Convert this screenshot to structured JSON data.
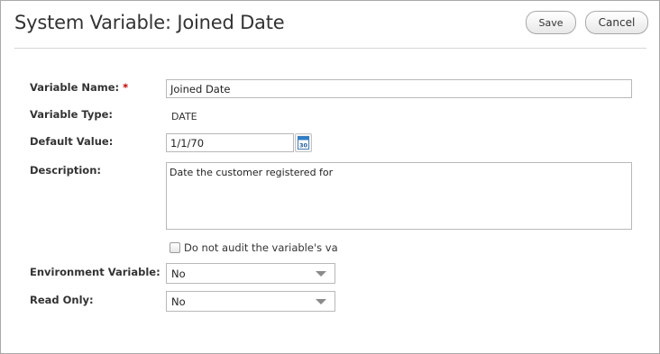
{
  "header": {
    "title": "System Variable: Joined Date",
    "save_label": "Save",
    "cancel_label": "Cancel"
  },
  "form": {
    "variable_name": {
      "label": "Variable Name:",
      "required_mark": "*",
      "value": "Joined Date"
    },
    "variable_type": {
      "label": "Variable Type:",
      "value": "DATE"
    },
    "default_value": {
      "label": "Default Value:",
      "value": "1/1/70",
      "calendar_day": "30"
    },
    "description": {
      "label": "Description:",
      "value": "Date the customer registered for"
    },
    "audit_checkbox": {
      "label": "Do not audit the variable's va",
      "checked": false
    },
    "environment_variable": {
      "label": "Environment Variable:",
      "selected": "No"
    },
    "read_only": {
      "label": "Read Only:",
      "selected": "No"
    }
  },
  "colors": {
    "required": "#c00000",
    "border": "#b8b8b8",
    "calendar_accent": "#2f7fc8"
  }
}
